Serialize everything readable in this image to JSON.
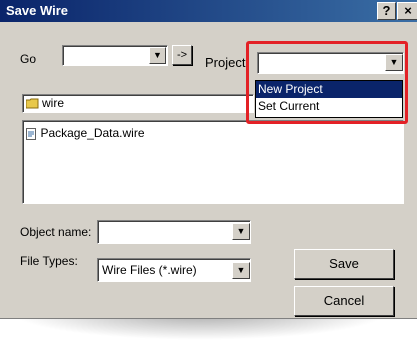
{
  "window": {
    "title": "Save Wire",
    "help_label": "?",
    "close_label": "×"
  },
  "toolbar": {
    "go_label": "Go",
    "go_value": "",
    "go_arrow": "->",
    "project_label": "Project",
    "project_value": ""
  },
  "project_menu": {
    "items": [
      "New Project",
      "Set Current"
    ],
    "selected_index": 0
  },
  "folder": {
    "name": "wire"
  },
  "files": [
    {
      "name": "Package_Data.wire"
    }
  ],
  "form": {
    "object_name_label": "Object name:",
    "object_name_value": "",
    "file_types_label": "File Types:",
    "file_types_value": "Wire Files (*.wire)"
  },
  "buttons": {
    "save_label": "Save",
    "cancel_label": "Cancel"
  },
  "colors": {
    "highlight": "#e32126",
    "titlebar": "#0a246a",
    "menu_selected": "#0a246a"
  }
}
